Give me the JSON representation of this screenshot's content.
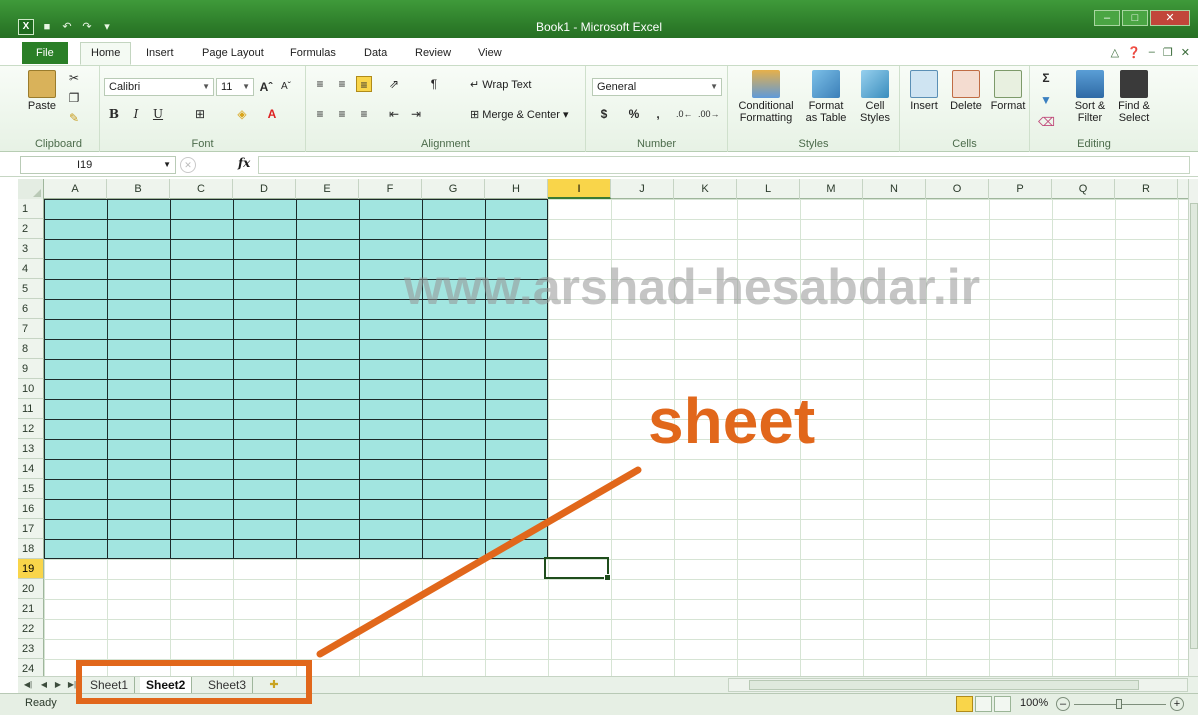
{
  "window": {
    "title": "Book1 - Microsoft Excel"
  },
  "ribbon": {
    "tabs": [
      "File",
      "Home",
      "Insert",
      "Page Layout",
      "Formulas",
      "Data",
      "Review",
      "View"
    ],
    "active_tab": "Home",
    "clipboard": {
      "paste": "Paste",
      "label": "Clipboard"
    },
    "font": {
      "name": "Calibri",
      "size": "11",
      "bold": "B",
      "italic": "I",
      "underline": "U",
      "label": "Font"
    },
    "alignment": {
      "wrap_text": "Wrap Text",
      "merge_center": "Merge & Center",
      "label": "Alignment"
    },
    "number": {
      "format": "General",
      "currency": "$",
      "percent": "%",
      "comma": ",",
      "label": "Number"
    },
    "styles": {
      "conditional": "Conditional",
      "conditional2": "Formatting",
      "format_table": "Format",
      "format_table2": "as Table",
      "cell_styles": "Cell",
      "cell_styles2": "Styles",
      "label": "Styles"
    },
    "cells": {
      "insert": "Insert",
      "delete": "Delete",
      "format": "Format",
      "label": "Cells"
    },
    "editing": {
      "sort": "Sort &",
      "sort2": "Filter",
      "find": "Find &",
      "find2": "Select",
      "label": "Editing"
    }
  },
  "formula_bar": {
    "name_box": "I19",
    "fx": "fx",
    "value": ""
  },
  "grid": {
    "columns": [
      "A",
      "B",
      "C",
      "D",
      "E",
      "F",
      "G",
      "H",
      "I",
      "J",
      "K",
      "L",
      "M",
      "N",
      "O",
      "P",
      "Q",
      "R"
    ],
    "rows": [
      "1",
      "2",
      "3",
      "4",
      "5",
      "6",
      "7",
      "8",
      "9",
      "10",
      "11",
      "12",
      "13",
      "14",
      "15",
      "16",
      "17",
      "18",
      "19",
      "20",
      "21",
      "22",
      "23",
      "24"
    ],
    "selected_column": "I",
    "selected_row": "19",
    "filled_range": "A1:H18",
    "fill_color": "#a2e5e0"
  },
  "sheets": {
    "tabs": [
      "Sheet1",
      "Sheet2",
      "Sheet3"
    ],
    "active": "Sheet2"
  },
  "status": {
    "ready": "Ready",
    "zoom": "100%"
  },
  "overlay": {
    "watermark": "www.arshad-hesabdar.ir",
    "callout": "sheet",
    "callout_color": "#e1671b"
  }
}
